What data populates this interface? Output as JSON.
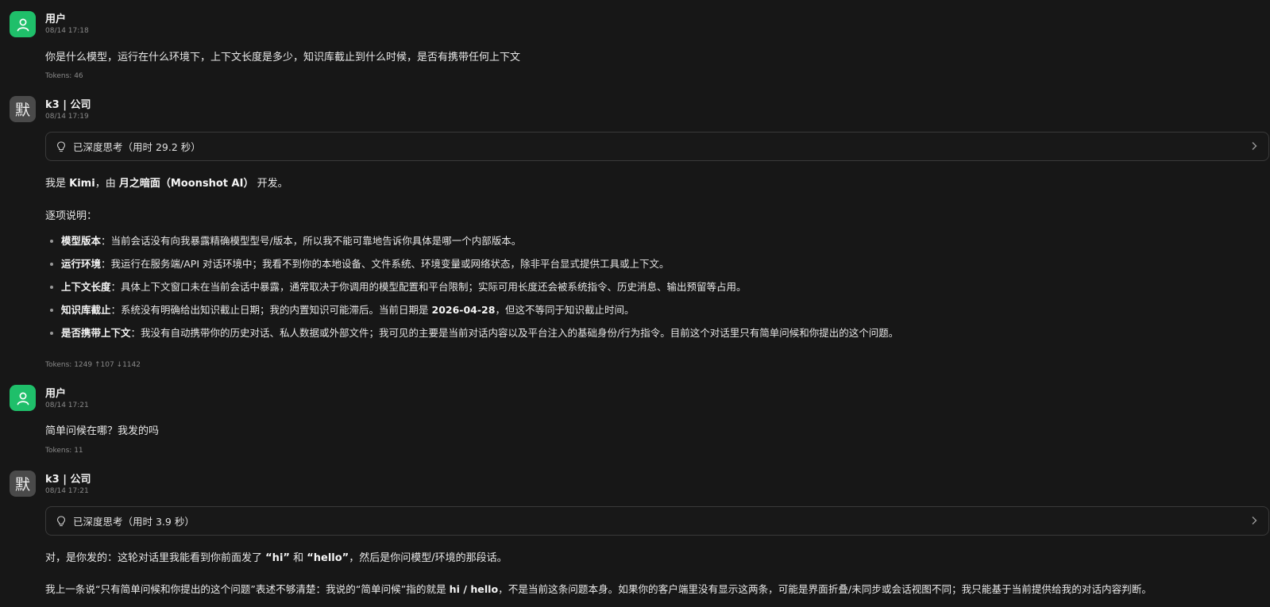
{
  "messages": [
    {
      "role": "user",
      "name": "用户",
      "time": "08/14 17:18",
      "text": "你是什么模型，运行在什么环境下，上下文长度是多少，知识库截止到什么时候，是否有携带任何上下文",
      "tokens": "Tokens: 46"
    },
    {
      "role": "assistant",
      "avatar_text": "默",
      "name": "k3 | 公司",
      "time": "08/14 17:19",
      "think_label": "已深度思考（用时 29.2 秒）",
      "intro": {
        "p1": "我是 ",
        "b1": "Kimi",
        "p2": "，由 ",
        "b2": "月之暗面（Moonshot AI）",
        "p3": " 开发。"
      },
      "subhead": "逐项说明：",
      "items": [
        {
          "label": "模型版本",
          "text": "：当前会话没有向我暴露精确模型型号/版本，所以我不能可靠地告诉你具体是哪一个内部版本。"
        },
        {
          "label": "运行环境",
          "text": "：我运行在服务端/API 对话环境中；我看不到你的本地设备、文件系统、环境变量或网络状态，除非平台显式提供工具或上下文。"
        },
        {
          "label": "上下文长度",
          "text": "：具体上下文窗口未在当前会话中暴露，通常取决于你调用的模型配置和平台限制；实际可用长度还会被系统指令、历史消息、输出预留等占用。"
        },
        {
          "label": "知识库截止",
          "text": "：系统没有明确给出知识截止日期；我的内置知识可能滞后。当前日期是 ",
          "bold2": "2026-04-28",
          "text2": "，但这不等同于知识截止时间。"
        },
        {
          "label": "是否携带上下文",
          "text": "：我没有自动携带你的历史对话、私人数据或外部文件；我可见的主要是当前对话内容以及平台注入的基础身份/行为指令。目前这个对话里只有简单问候和你提出的这个问题。"
        }
      ],
      "tokens": "Tokens: 1249 ↑107 ↓1142"
    },
    {
      "role": "user",
      "name": "用户",
      "time": "08/14 17:21",
      "text": "简单问候在哪？我发的吗",
      "tokens": "Tokens: 11"
    },
    {
      "role": "assistant",
      "avatar_text": "默",
      "name": "k3 | 公司",
      "time": "08/14 17:21",
      "think_label": "已深度思考（用时 3.9 秒）",
      "line1": {
        "p1": "对，是你发的：这轮对话里我能看到你前面发了 ",
        "b1": "“hi”",
        "p2": " 和 ",
        "b2": "“hello”",
        "p3": "，然后是你问模型/环境的那段话。"
      },
      "line2": {
        "p1": "我上一条说“只有简单问候和你提出的这个问题”表述不够清楚：我说的“简单问候”指的就是 ",
        "b1": "hi / hello",
        "p2": "，不是当前这条问题本身。如果你的客户端里没有显示这两条，可能是界面折叠/未同步或会话视图不同；我只能基于当前提供给我的对话内容判断。"
      }
    }
  ],
  "colors": {
    "background": "#171717",
    "user_avatar": "#1fbf6a",
    "ai_avatar": "#4a4a4a",
    "border": "#3a3a3a"
  },
  "icons": {
    "user_avatar": "user-icon",
    "think": "lightbulb-icon",
    "expand": "chevron-right-icon"
  }
}
